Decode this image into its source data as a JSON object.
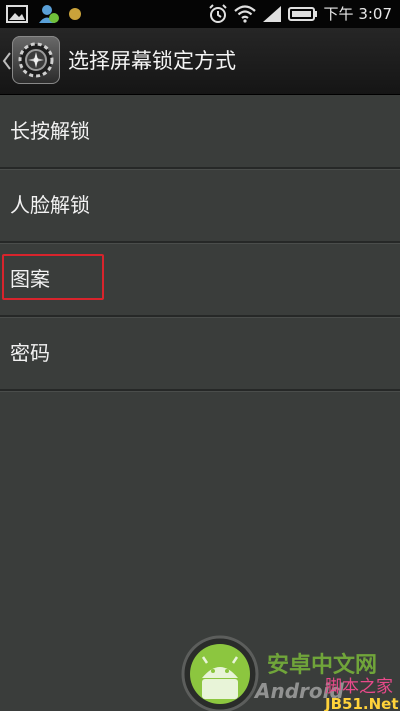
{
  "status_bar": {
    "time": "下午 3:07",
    "icons": [
      "gallery-notification-icon",
      "contact-notification-icon",
      "dot-notification-icon",
      "alarm-icon",
      "wifi-icon",
      "signal-icon",
      "battery-icon"
    ]
  },
  "action_bar": {
    "title": "选择屏幕锁定方式",
    "icon": "settings-gear-icon"
  },
  "options": [
    {
      "label": "长按解锁"
    },
    {
      "label": "人脸解锁"
    },
    {
      "label": "图案",
      "highlighted": true
    },
    {
      "label": "密码"
    }
  ],
  "watermark": {
    "site_cn": "安卓中文网",
    "site_en": "Android",
    "site2": "脚本之家",
    "site2_url": "JB51.Net"
  },
  "colors": {
    "background": "#3a3d3b",
    "status_bar": "#050505",
    "highlight": "#d8242c",
    "accent_green": "#8cc63f"
  }
}
